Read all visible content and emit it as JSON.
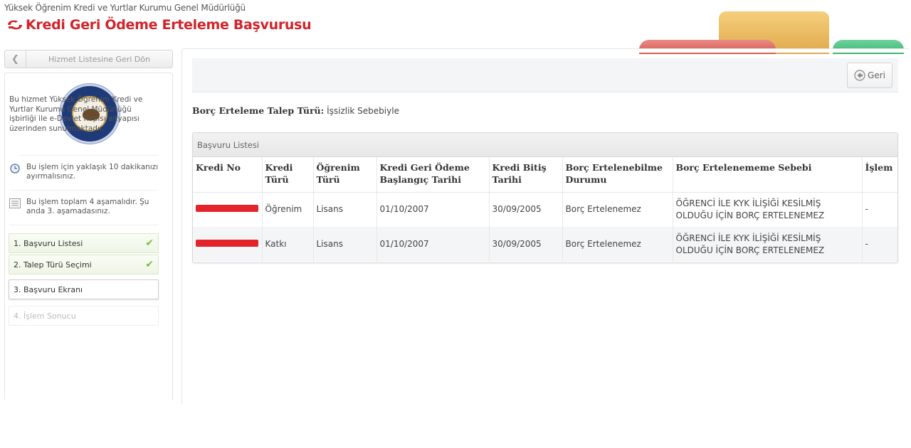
{
  "header": {
    "org_name": "Yüksek Öğrenim Kredi ve Yurtlar Kurumu Genel Müdürlüğü",
    "title": "Kredi Geri Ödeme Erteleme Başvurusu"
  },
  "sidebar": {
    "back_label": "Hizmet Listesine Geri Dön",
    "description": "Bu hizmet Yüksek Öğrenim Kredi ve Yurtlar Kurumu Genel Müdürlüğü işbirliği ile e-Devlet Kapısı altyapısı üzerinden sunulmaktadır.",
    "info_time": "Bu işlem için yaklaşık 10 dakikanızı ayırmalısınız.",
    "info_steps": "Bu işlem toplam 4 aşamalıdır. Şu anda 3. aşamadasınız.",
    "steps": [
      {
        "label": "1. Başvuru Listesi",
        "status": "done"
      },
      {
        "label": "2. Talep Türü Seçimi",
        "status": "done"
      },
      {
        "label": "3. Başvuru Ekranı",
        "status": "current"
      },
      {
        "label": "4. İşlem Sonucu",
        "status": "pending"
      }
    ]
  },
  "toolbar": {
    "back_button": "Geri"
  },
  "request_type": {
    "label": "Borç Erteleme Talep Türü:",
    "value": "İşsizlik Sebebiyle"
  },
  "table": {
    "title": "Başvuru Listesi",
    "columns": [
      "Kredi No",
      "Kredi Türü",
      "Öğrenim Türü",
      "Kredi Geri Ödeme Başlangıç Tarihi",
      "Kredi Bitiş Tarihi",
      "Borç Ertelenebilme Durumu",
      "Borç Ertelenememe Sebebi",
      "İşlem"
    ],
    "rows": [
      [
        "",
        "Öğrenim",
        "Lisans",
        "01/10/2007",
        "30/09/2005",
        "Borç Ertelenemez",
        "ÖĞRENCİ İLE KYK İLİŞİĞİ KESİLMİŞ OLDUĞU İÇİN BORÇ ERTELENEMEZ",
        "-"
      ],
      [
        "",
        "Katkı",
        "Lisans",
        "01/10/2007",
        "30/09/2005",
        "Borç Ertelenemez",
        "ÖĞRENCİ İLE KYK İLİŞİĞİ KESİLMİŞ OLDUĞU İÇİN BORÇ ERTELENEMEZ",
        "-"
      ]
    ]
  },
  "colors": {
    "brand_red": "#d2232a",
    "redaction": "#e3242b",
    "step_check": "#7cbf3c"
  }
}
